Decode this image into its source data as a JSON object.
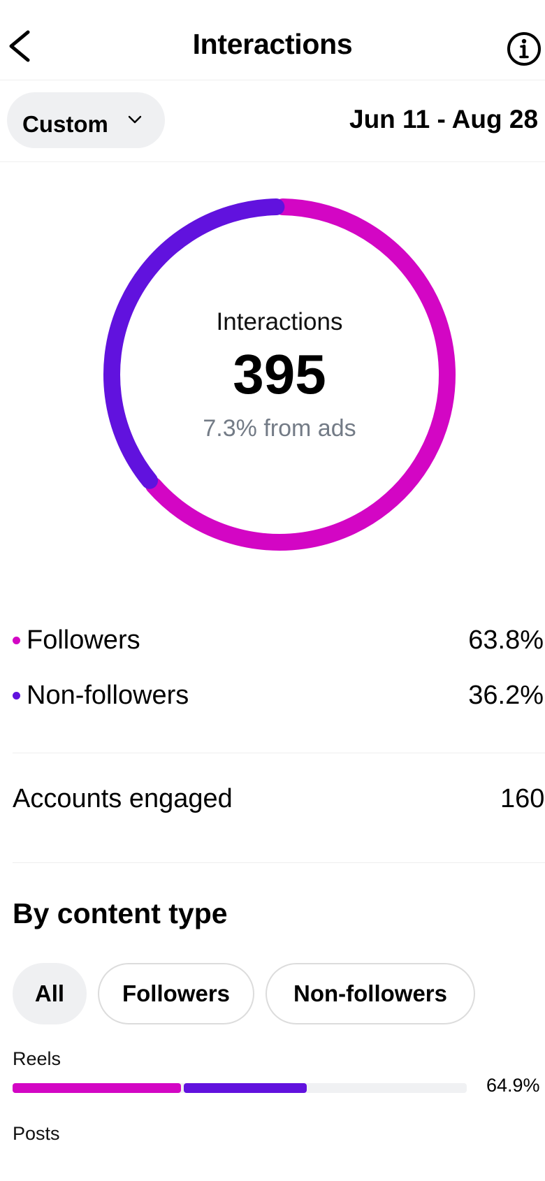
{
  "header": {
    "title": "Interactions"
  },
  "filter": {
    "period_label": "Custom",
    "date_range": "Jun 11 - Aug 28"
  },
  "summary": {
    "label": "Interactions",
    "value": "395",
    "sub": "7.3% from ads"
  },
  "breakdown": [
    {
      "label": "Followers",
      "percent": "63.8%",
      "share": 63.8,
      "color": "#d306c4"
    },
    {
      "label": "Non-followers",
      "percent": "36.2%",
      "share": 36.2,
      "color": "#6112de"
    }
  ],
  "accounts_engaged": {
    "label": "Accounts engaged",
    "value": "160"
  },
  "content_type": {
    "title": "By content type",
    "chips": [
      "All",
      "Followers",
      "Non-followers"
    ],
    "selected": "All",
    "rows": [
      {
        "label": "Reels",
        "percent": "64.9%",
        "followers_share": 37.4,
        "nonfollowers_share": 27.3
      },
      {
        "label": "Posts"
      }
    ]
  },
  "colors": {
    "followers": "#d306c4",
    "non_followers": "#6112de",
    "track": "#f0f1f3",
    "muted_text": "#737b86"
  }
}
